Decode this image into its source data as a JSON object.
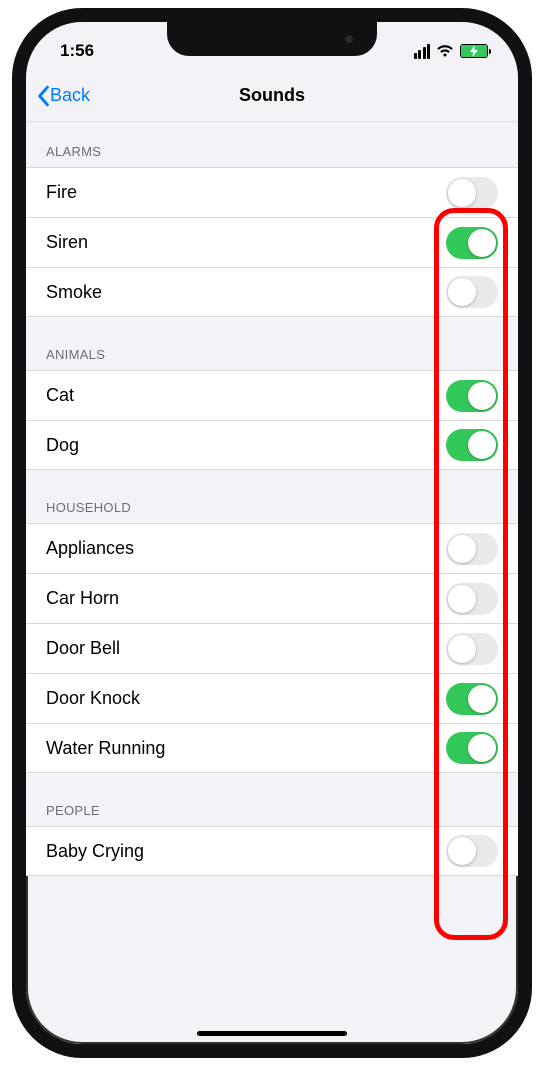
{
  "status": {
    "time": "1:56"
  },
  "nav": {
    "back": "Back",
    "title": "Sounds"
  },
  "sections": [
    {
      "header": "ALARMS",
      "rows": [
        {
          "label": "Fire",
          "on": false
        },
        {
          "label": "Siren",
          "on": true
        },
        {
          "label": "Smoke",
          "on": false
        }
      ]
    },
    {
      "header": "ANIMALS",
      "rows": [
        {
          "label": "Cat",
          "on": true
        },
        {
          "label": "Dog",
          "on": true
        }
      ]
    },
    {
      "header": "HOUSEHOLD",
      "rows": [
        {
          "label": "Appliances",
          "on": false
        },
        {
          "label": "Car Horn",
          "on": false
        },
        {
          "label": "Door Bell",
          "on": false
        },
        {
          "label": "Door Knock",
          "on": true
        },
        {
          "label": "Water Running",
          "on": true
        }
      ]
    },
    {
      "header": "PEOPLE",
      "rows": [
        {
          "label": "Baby Crying",
          "on": false
        }
      ]
    }
  ]
}
